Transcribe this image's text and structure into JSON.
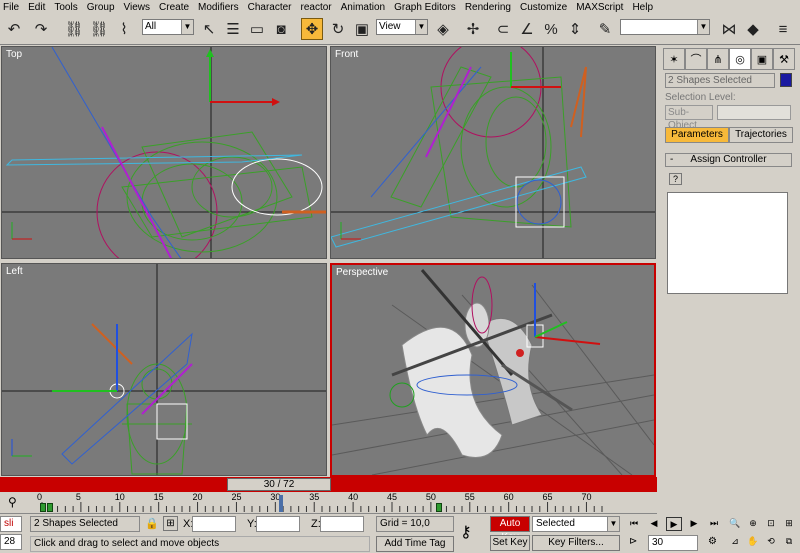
{
  "menu": [
    "File",
    "Edit",
    "Tools",
    "Group",
    "Views",
    "Create",
    "Modifiers",
    "Character",
    "reactor",
    "Animation",
    "Graph Editors",
    "Rendering",
    "Customize",
    "MAXScript",
    "Help"
  ],
  "toolbar": {
    "selection_filter": "All",
    "ref_coord": "View",
    "named_selection": ""
  },
  "viewports": {
    "top": "Top",
    "front": "Front",
    "left": "Left",
    "perspective": "Perspective"
  },
  "cmd_panel": {
    "selection_name": "2 Shapes Selected",
    "selection_color": "#1a1aa0",
    "selection_level_label": "Selection Level:",
    "sub_object": "Sub-Object",
    "parameters_tab": "Parameters",
    "trajectories_tab": "Trajectories",
    "rollout_title": "Assign Controller",
    "rollout_toggle": "-"
  },
  "timeline": {
    "frame_display": "30 / 72",
    "ticks": [
      "0",
      "5",
      "10",
      "15",
      "20",
      "25",
      "30",
      "35",
      "40",
      "45",
      "50",
      "55",
      "60",
      "65",
      "70"
    ]
  },
  "status": {
    "selected_count": "2 Shapes Selected",
    "prompt": "Click and drag to select and move objects",
    "x_label": "X:",
    "y_label": "Y:",
    "z_label": "Z:",
    "grid": "Grid = 10,0",
    "add_time_tag": "Add Time Tag",
    "auto_key": "Auto Key",
    "set_key": "Set Key",
    "key_mode": "Selected",
    "key_filters": "Key Filters...",
    "current_frame": "30",
    "script_listener": "sli",
    "line_num": "28"
  }
}
